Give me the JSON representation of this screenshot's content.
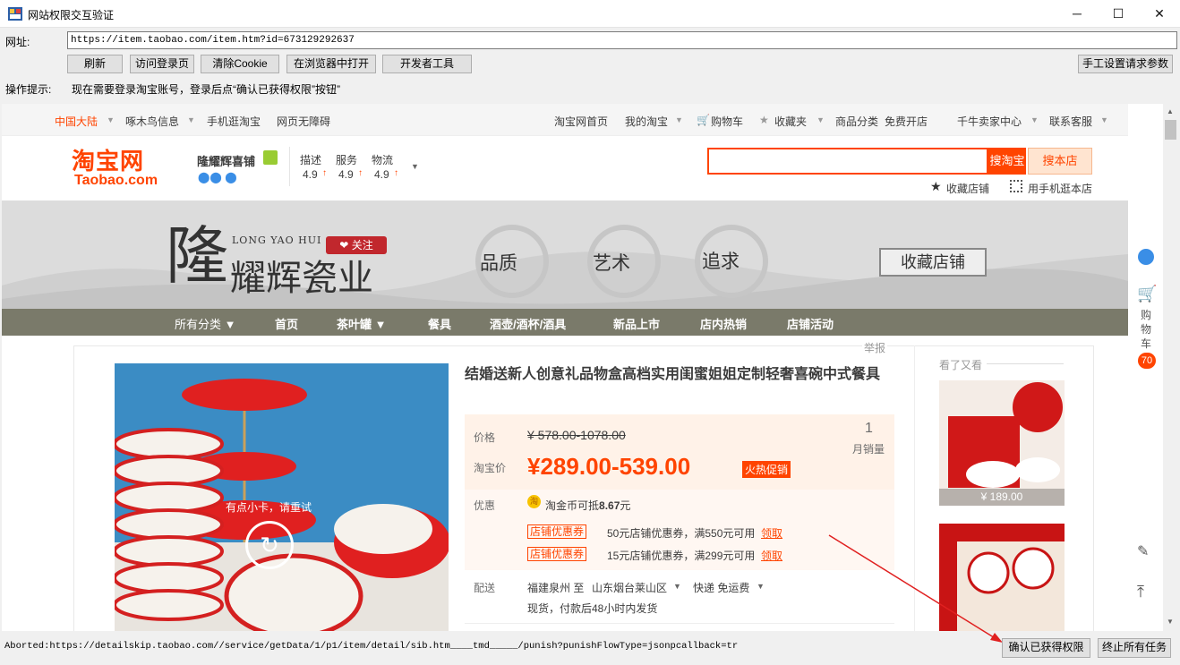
{
  "window": {
    "title": "网站权限交互验证",
    "min": "─",
    "max": "☐",
    "close": "✕"
  },
  "toolbar": {
    "url_label": "网址:",
    "url_value": "https://item.taobao.com/item.htm?id=673129292637",
    "buttons": [
      "刷新",
      "访问登录页",
      "清除Cookie",
      "在浏览器中打开",
      "开发者工具"
    ],
    "manual_params": "手工设置请求参数",
    "hint_label": "操作提示:",
    "hint_text": "现在需要登录淘宝账号，登录后点“确认已获得权限”按钮”"
  },
  "taobao": {
    "topnav_left": [
      "中国大陆",
      "啄木鸟信息",
      "手机逛淘宝",
      "网页无障碍"
    ],
    "topnav_right": [
      "淘宝网首页",
      "我的淘宝",
      "购物车",
      "收藏夹",
      "商品分类",
      "免费开店",
      "千牛卖家中心",
      "联系客服"
    ],
    "logo_cn": "淘宝网",
    "logo_en": "Taobao.com",
    "shop_name": "隆耀辉喜铺",
    "ratings": [
      {
        "label": "描述",
        "value": "4.9"
      },
      {
        "label": "服务",
        "value": "4.9"
      },
      {
        "label": "物流",
        "value": "4.9"
      }
    ],
    "search_btn": "搜淘宝",
    "search_shop_btn": "搜本店",
    "fav_shop": "收藏店铺",
    "mobile_shop": "用手机逛本店",
    "banner": {
      "big_char": "隆",
      "pinyin": "LONG YAO HUI",
      "follow": "关注",
      "sub": "耀辉瓷业",
      "circles": [
        "品质",
        "艺术",
        "追求"
      ],
      "fav_btn": "收藏店铺"
    },
    "categories": [
      "所有分类 ▼",
      "首页",
      "茶叶罐 ▼",
      "餐具",
      "酒壶/酒杯/酒具",
      "新品上市",
      "店内热销",
      "店铺活动"
    ],
    "report": "举报",
    "product_title": "结婚送新人创意礼品物盒高档实用闺蜜姐姐定制轻奢喜碗中式餐具",
    "price_label": "价格",
    "price_original": "¥ 578.00-1078.00",
    "sales_count": "1",
    "sales_label": "月销量",
    "tbprice_label": "淘宝价",
    "price_now": "¥289.00-539.00",
    "promo_tag": "火热促销",
    "discount_label": "优惠",
    "coin_text": "淘金币可抵",
    "coin_value": "8.67",
    "coin_unit": "元",
    "coupons": [
      {
        "tag": "店铺优惠券",
        "text": "50元店铺优惠券，满550元可用",
        "get": "领取"
      },
      {
        "tag": "店铺优惠券",
        "text": "15元店铺优惠券，满299元可用",
        "get": "领取"
      }
    ],
    "ship_label": "配送",
    "ship_from": "福建泉州 至",
    "ship_to": "山东烟台莱山区",
    "ship_fee": "快递 免运费",
    "ship_time": "现货，付款后48小时内发货",
    "image_overlay": "有点小卡，请重试",
    "seen_title": "看了又看",
    "seen_price": "¥ 189.00",
    "side": {
      "cart": "购物车",
      "cart_count": "70"
    }
  },
  "status": {
    "text": "Aborted:https://detailskip.taobao.com//service/getData/1/p1/item/detail/sib.htm____tmd_____/punish?punishFlowType=jsonpcallback=tr"
  },
  "actions": {
    "confirm": "确认已获得权限",
    "stop": "终止所有任务"
  }
}
